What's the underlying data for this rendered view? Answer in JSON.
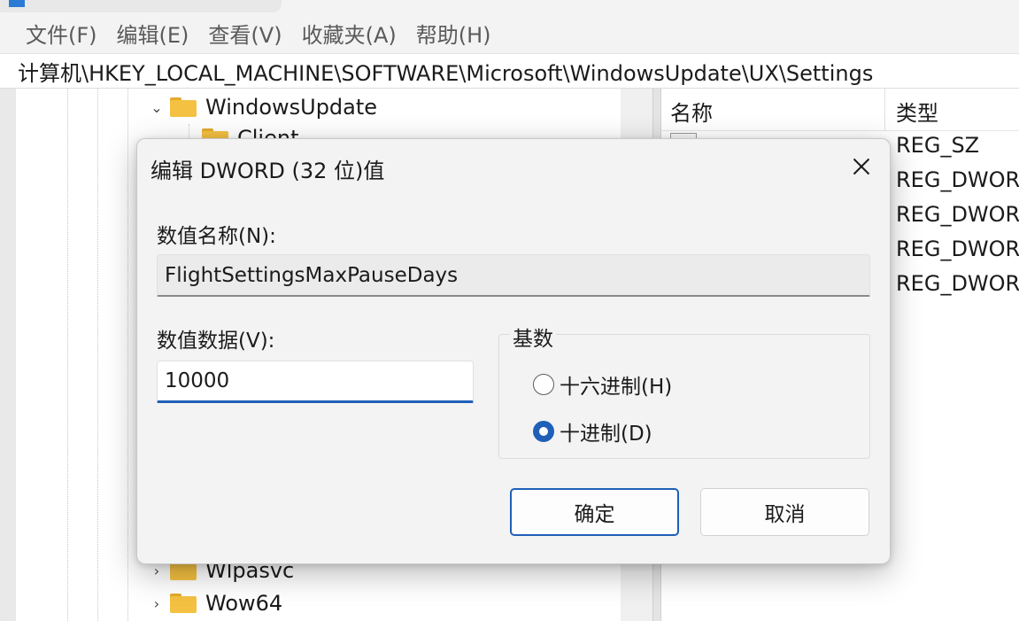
{
  "menubar": {
    "items": [
      "文件(F)",
      "编辑(E)",
      "查看(V)",
      "收藏夹(A)",
      "帮助(H)"
    ]
  },
  "address": {
    "path": "计算机\\HKEY_LOCAL_MACHINE\\SOFTWARE\\Microsoft\\WindowsUpdate\\UX\\Settings"
  },
  "tree": {
    "items": [
      {
        "label": "WindowsUpdate",
        "expanded": true
      },
      {
        "label": "Client"
      },
      {
        "label": "Wlpasvc",
        "collapsed": true
      },
      {
        "label": "Wow64",
        "collapsed": true
      }
    ]
  },
  "list": {
    "columns": {
      "name": "名称",
      "type": "类型"
    },
    "types": [
      "REG_SZ",
      "REG_DWOR",
      "REG_DWOR",
      "REG_DWOR",
      "REG_DWOR"
    ]
  },
  "dialog": {
    "title": "编辑 DWORD (32 位)值",
    "name_label": "数值名称(N):",
    "name_value": "FlightSettingsMaxPauseDays",
    "data_label": "数值数据(V):",
    "data_value": "10000",
    "base_group": "基数",
    "radio_hex": "十六进制(H)",
    "radio_dec": "十进制(D)",
    "selected_base": "decimal",
    "ok": "确定",
    "cancel": "取消"
  },
  "colors": {
    "accent": "#1f5fb8",
    "folder": "#f4c142",
    "dialog_bg": "#f3f3f3"
  }
}
